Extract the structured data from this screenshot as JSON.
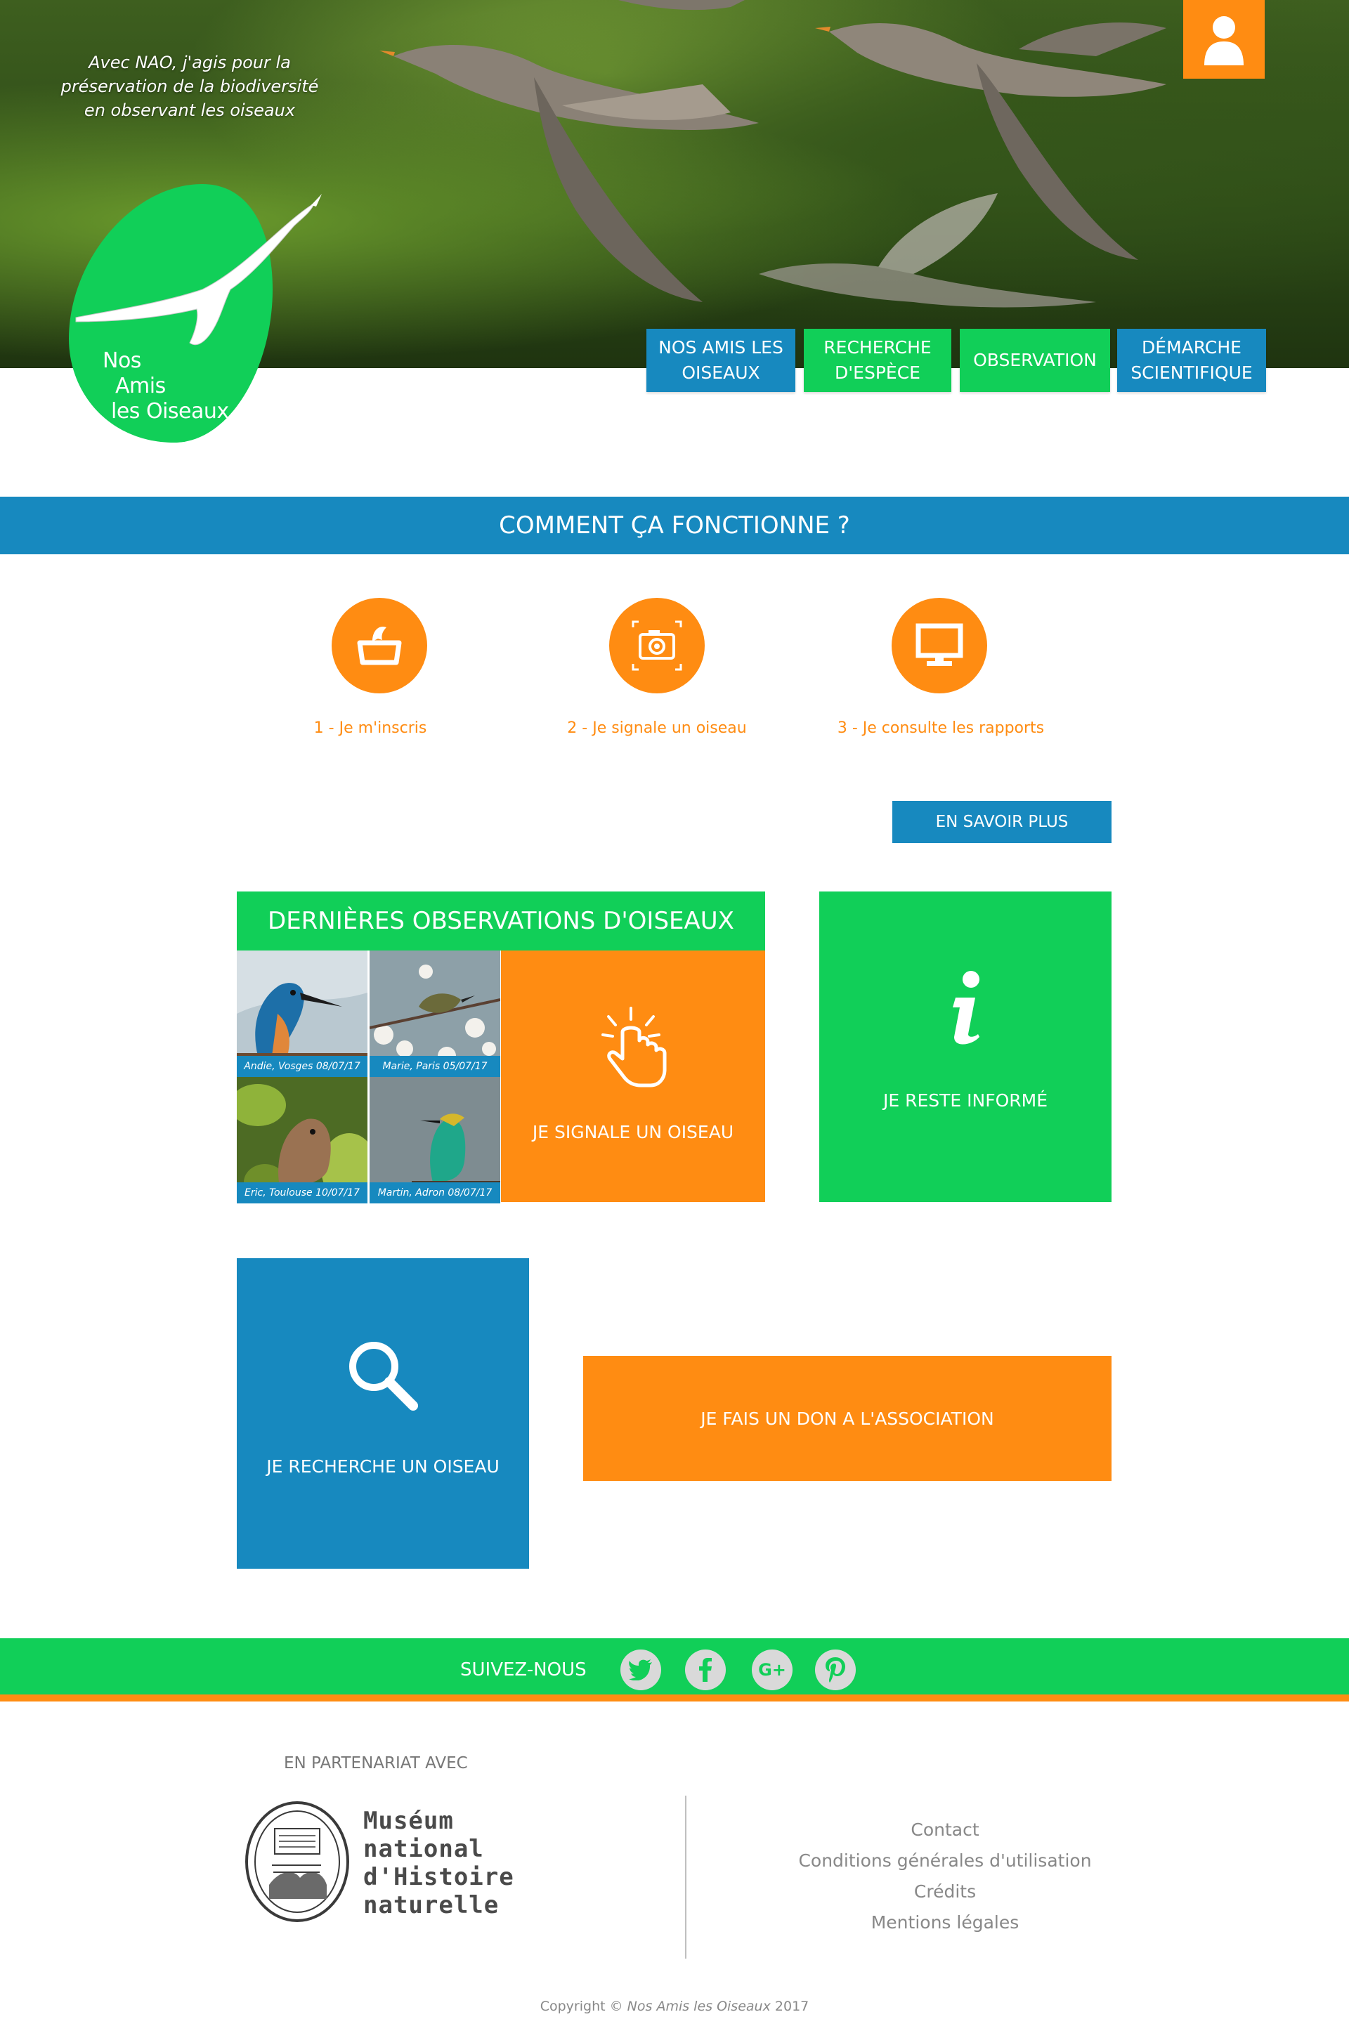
{
  "hero": {
    "tagline": "Avec NAO, j'agis pour la préservation de la biodiversité en observant les oiseaux",
    "user_icon": "user-icon"
  },
  "logo": {
    "line1": "Nos",
    "line2": "Amis",
    "line3": "les Oiseaux"
  },
  "nav": [
    {
      "label": "NOS AMIS LES OISEAUX"
    },
    {
      "label": "RECHERCHE D'ESPÈCE"
    },
    {
      "label": "OBSERVATION"
    },
    {
      "label": "DÉMARCHE SCIENTIFIQUE"
    }
  ],
  "how_it_works": {
    "title": "COMMENT ÇA FONCTIONNE ?",
    "steps": [
      {
        "label": "1 - Je m'inscris",
        "icon": "signup-icon"
      },
      {
        "label": "2 - Je signale un oiseau",
        "icon": "camera-icon"
      },
      {
        "label": "3 - Je consulte les rapports",
        "icon": "monitor-icon"
      }
    ],
    "more_button": "EN SAVOIR PLUS"
  },
  "observations": {
    "title": "DERNIÈRES OBSERVATIONS D'OISEAUX",
    "items": [
      {
        "caption": "Andie, Vosges 08/07/17"
      },
      {
        "caption": "Marie, Paris 05/07/17"
      },
      {
        "caption": "Eric, Toulouse 10/07/17"
      },
      {
        "caption": "Martin, Adron 08/07/17"
      }
    ]
  },
  "tiles": {
    "report": "JE SIGNALE UN OISEAU",
    "informed": "JE RESTE INFORMÉ",
    "search": "JE RECHERCHE UN OISEAU",
    "donate": "JE FAIS UN DON A L'ASSOCIATION"
  },
  "follow": {
    "label": "SUIVEZ-NOUS",
    "networks": [
      "twitter-icon",
      "facebook-icon",
      "google-plus-icon",
      "pinterest-icon"
    ]
  },
  "footer": {
    "partner_label": "EN PARTENARIAT AVEC",
    "museum": {
      "line1": "Muséum",
      "line2": "national",
      "line3": "d'Histoire",
      "line4": "naturelle"
    },
    "links": [
      {
        "label": "Contact"
      },
      {
        "label": "Conditions générales d'utilisation"
      },
      {
        "label": "Crédits"
      },
      {
        "label": "Mentions légales"
      }
    ],
    "copyright_prefix": "Copyright ©",
    "copyright_name": "Nos Amis les Oiseaux",
    "copyright_year": "2017"
  },
  "colors": {
    "blue": "#1789bf",
    "green": "#11cf58",
    "orange": "#ff8c12"
  }
}
